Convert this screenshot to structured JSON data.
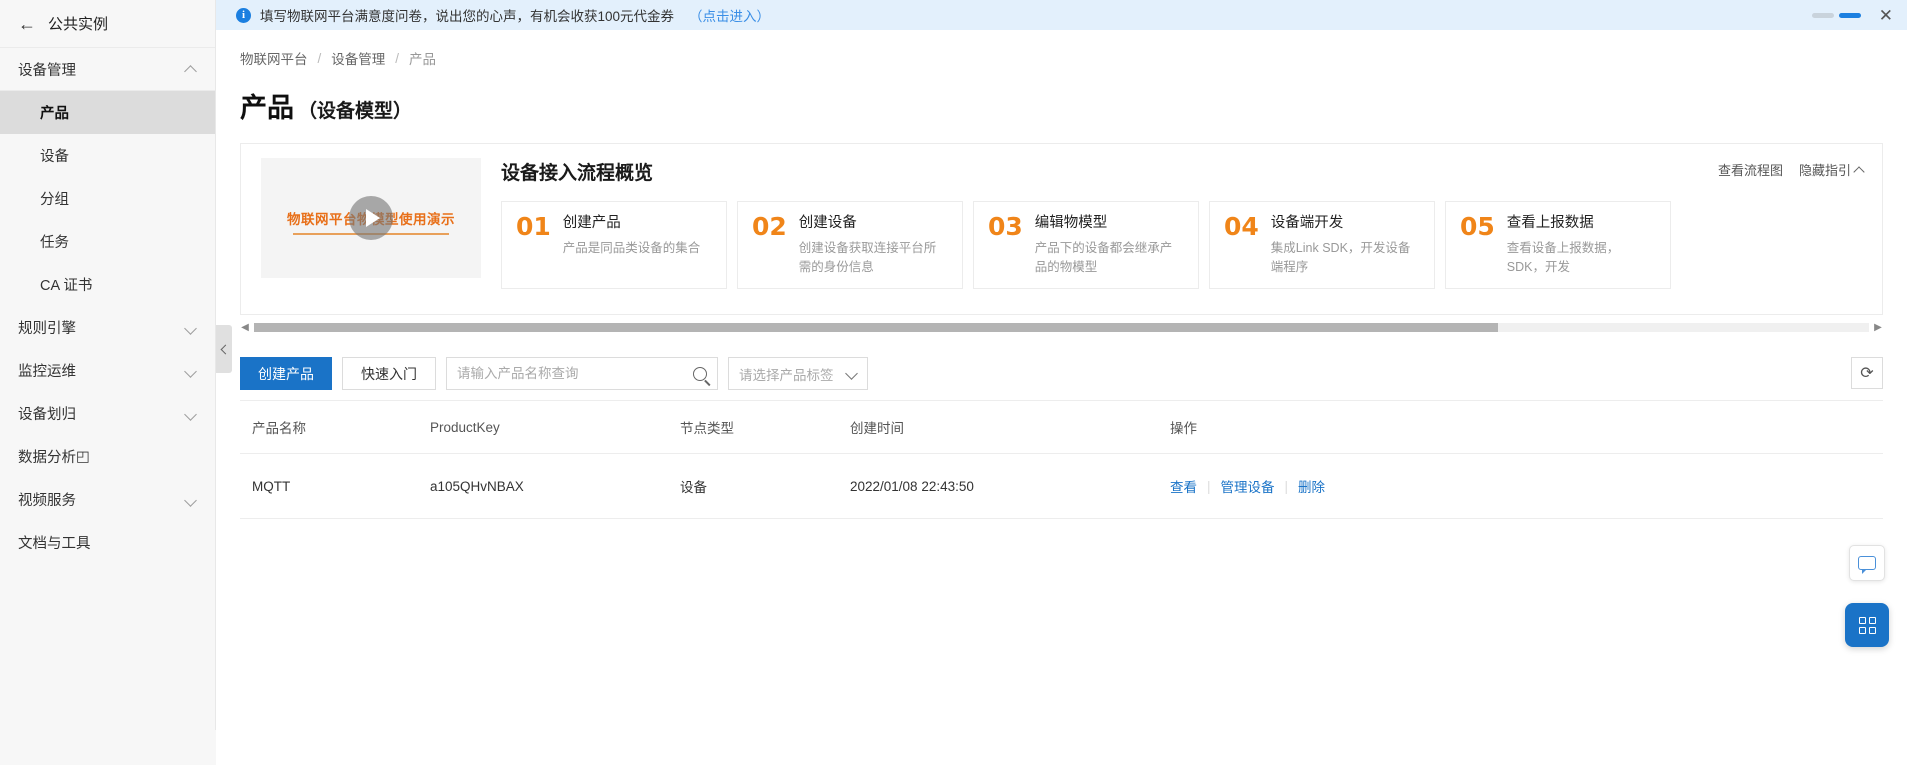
{
  "sidebar": {
    "back": {
      "label": "公共实例",
      "icon": "arrow-left-icon"
    },
    "groups": [
      {
        "label": "设备管理",
        "expanded": true,
        "chevron": "chevron-up-icon"
      },
      {
        "label": "规则引擎",
        "expanded": false,
        "chevron": "chevron-down-icon"
      },
      {
        "label": "监控运维",
        "expanded": false,
        "chevron": "chevron-down-icon"
      },
      {
        "label": "设备划归",
        "expanded": false,
        "chevron": "chevron-down-icon"
      },
      {
        "label": "视频服务",
        "expanded": false,
        "chevron": "chevron-down-icon"
      }
    ],
    "device_items": [
      {
        "label": "产品",
        "active": true
      },
      {
        "label": "设备",
        "active": false
      },
      {
        "label": "分组",
        "active": false
      },
      {
        "label": "任务",
        "active": false
      },
      {
        "label": "CA 证书",
        "active": false
      }
    ],
    "data_analysis": {
      "label": "数据分析",
      "external_icon": "external-link-icon"
    },
    "docs": {
      "label": "文档与工具"
    },
    "collapse_handle_icon": "chevron-left-icon"
  },
  "banner": {
    "icon": "info-circle-icon",
    "text": "填写物联网平台满意度问卷，说出您的心声，有机会收获100元代金券",
    "link": "（点击进入）",
    "close_icon": "close-icon",
    "carousel_dots": 2,
    "carousel_active_index": 1
  },
  "breadcrumb": {
    "items": [
      "物联网平台",
      "设备管理",
      "产品"
    ],
    "separator": "/"
  },
  "page": {
    "title": "产品",
    "subtitle": "（设备模型）"
  },
  "guide": {
    "title": "设备接入流程概览",
    "video": {
      "caption": "物联网平台物模型使用演示",
      "play_icon": "play-icon"
    },
    "actions": [
      {
        "label": "查看流程图",
        "icon": ""
      },
      {
        "label": "隐藏指引",
        "icon": "chevron-up-icon"
      }
    ],
    "steps": [
      {
        "num": "01",
        "title": "创建产品",
        "desc": "产品是同品类设备的集合"
      },
      {
        "num": "02",
        "title": "创建设备",
        "desc": "创建设备获取连接平台所需的身份信息"
      },
      {
        "num": "03",
        "title": "编辑物模型",
        "desc": "产品下的设备都会继承产品的物模型"
      },
      {
        "num": "04",
        "title": "设备端开发",
        "desc": "集成Link SDK，开发设备端程序"
      },
      {
        "num": "05",
        "title": "查看上报数据",
        "desc": "查看设备上报数据，SDK，开发"
      }
    ],
    "scroll": {
      "left_arrow": "chevron-left-icon",
      "right_arrow": "chevron-right-icon",
      "thumb_percent": 77
    }
  },
  "toolbar": {
    "create_label": "创建产品",
    "quickstart_label": "快速入门",
    "search": {
      "placeholder": "请输入产品名称查询",
      "value": "",
      "icon": "search-icon"
    },
    "tag_select": {
      "placeholder": "请选择产品标签",
      "value": "请选择产品标签",
      "icon": "chevron-down-icon"
    },
    "refresh": {
      "icon": "refresh-icon",
      "label": "⟳"
    }
  },
  "table": {
    "columns": [
      "产品名称",
      "ProductKey",
      "节点类型",
      "创建时间",
      "操作"
    ],
    "rows": [
      {
        "name": "MQTT",
        "product_key": "a105QHvNBAX",
        "node_type": "设备",
        "created_at": "2022/01/08 22:43:50",
        "actions": [
          "查看",
          "管理设备",
          "删除"
        ]
      }
    ]
  },
  "floating": {
    "chat": {
      "icon": "chat-bubble-icon"
    },
    "apps": {
      "icon": "grid-apps-icon"
    }
  },
  "colors": {
    "primary": "#1a73c7",
    "accent_orange": "#f08519",
    "banner_bg": "#e3f0fc",
    "sidebar_bg": "#f7f7f7",
    "active_item_bg": "#dcdcdc"
  }
}
